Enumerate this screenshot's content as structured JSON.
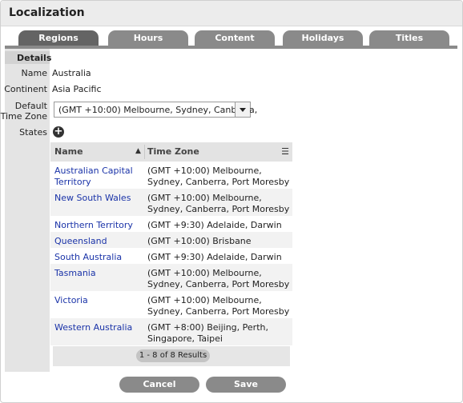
{
  "window": {
    "title": "Localization"
  },
  "tabs": [
    {
      "label": "Regions"
    },
    {
      "label": "Hours"
    },
    {
      "label": "Content"
    },
    {
      "label": "Holidays"
    },
    {
      "label": "Titles"
    }
  ],
  "active_tab": "Regions",
  "details": {
    "section_label": "Details",
    "name_label": "Name",
    "name_value": "Australia",
    "continent_label": "Continent",
    "continent_value": "Asia Pacific",
    "timezone_label_line1": "Default",
    "timezone_label_line2": "Time Zone",
    "timezone_value": "(GMT +10:00) Melbourne, Sydney, Canberra,",
    "states_label": "States"
  },
  "states_table": {
    "col_name": "Name",
    "col_timezone": "Time Zone",
    "rows": [
      {
        "name": "Australian Capital Territory",
        "timezone": "(GMT +10:00) Melbourne, Sydney, Canberra, Port Moresby"
      },
      {
        "name": "New South Wales",
        "timezone": "(GMT +10:00) Melbourne, Sydney, Canberra, Port Moresby"
      },
      {
        "name": "Northern Territory",
        "timezone": "(GMT +9:30) Adelaide, Darwin"
      },
      {
        "name": "Queensland",
        "timezone": "(GMT +10:00) Brisbane"
      },
      {
        "name": "South Australia",
        "timezone": "(GMT +9:30) Adelaide, Darwin"
      },
      {
        "name": "Tasmania",
        "timezone": "(GMT +10:00) Melbourne, Sydney, Canberra, Port Moresby"
      },
      {
        "name": "Victoria",
        "timezone": "(GMT +10:00) Melbourne, Sydney, Canberra, Port Moresby"
      },
      {
        "name": "Western Australia",
        "timezone": "(GMT +8:00) Beijing, Perth, Singapore, Taipei"
      }
    ],
    "pager_text": "1 - 8 of 8 Results"
  },
  "buttons": {
    "cancel": "Cancel",
    "save": "Save"
  },
  "colors": {
    "tab": "#8a8a8a",
    "tab_active": "#646464",
    "link": "#1a33a8"
  }
}
